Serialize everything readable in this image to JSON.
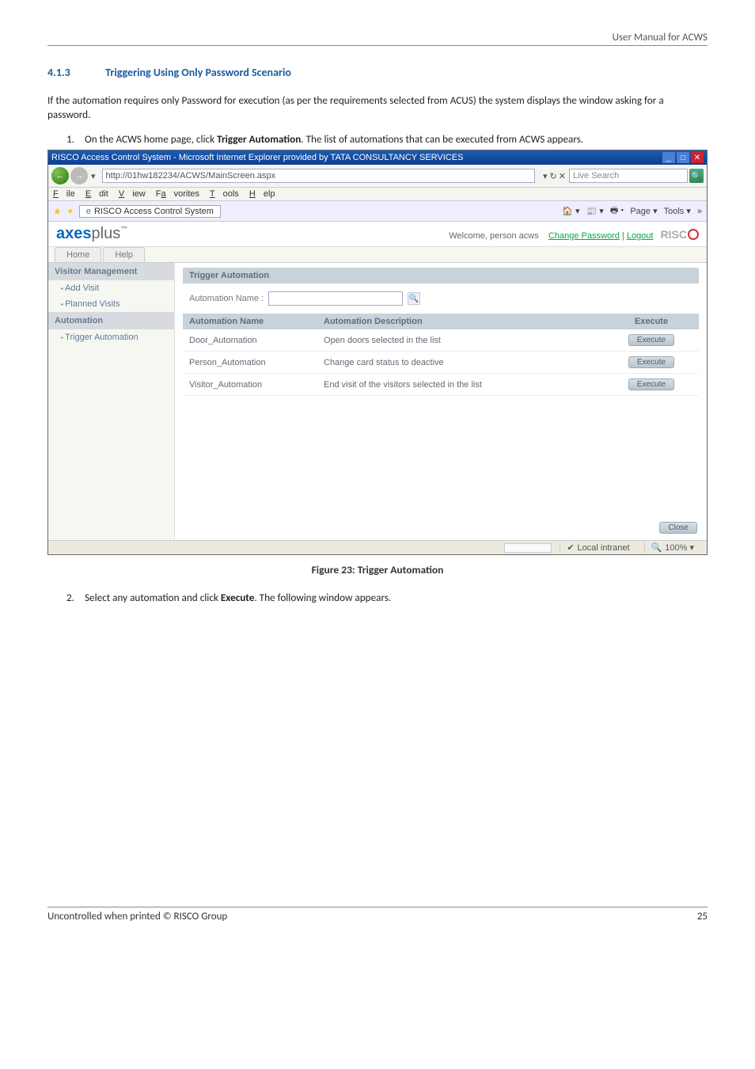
{
  "header": {
    "right": "User Manual for ACWS"
  },
  "section": {
    "number": "4.1.3",
    "title": "Triggering Using Only Password Scenario"
  },
  "body": {
    "para1": "If the automation requires only Password for execution (as per the requirements selected from ACUS) the system displays the window asking for a password.",
    "step1_prefix": "On the ACWS home page, click ",
    "step1_bold": "Trigger Automation",
    "step1_suffix": ". The list of automations that can be executed from ACWS appears.",
    "step2_prefix": "Select any automation and click ",
    "step2_bold": "Execute",
    "step2_suffix": ". The following window appears."
  },
  "figure": {
    "caption": "Figure 23: Trigger Automation"
  },
  "footer": {
    "left": "Uncontrolled when printed © RISCO Group",
    "right": "25"
  },
  "screenshot": {
    "titlebar": {
      "title": "RISCO Access Control System - Microsoft Internet Explorer provided by TATA CONSULTANCY SERVICES",
      "min": "_",
      "max": "□",
      "close": "✕"
    },
    "address": {
      "url": "http://01hw182234/ACWS/MainScreen.aspx",
      "live_search": "Live Search",
      "go": "→",
      "refresh_dd": "✕"
    },
    "menu": {
      "file": "File",
      "edit": "Edit",
      "view": "View",
      "favorites": "Favorites",
      "tools": "Tools",
      "help": "Help"
    },
    "tab": {
      "active": "RISCO Access Control System"
    },
    "ie_tools": {
      "page": "Page ▾",
      "tools": "Tools ▾"
    },
    "app": {
      "brand_axes": "axes",
      "brand_plus": "plus",
      "brand_tm": "™",
      "welcome": "Welcome, person acws",
      "change_pw": "Change Password",
      "sep": " | ",
      "logout": "Logout",
      "risco": "RISC"
    },
    "apptabs": {
      "home": "Home",
      "help": "Help"
    },
    "sidebar": {
      "group1": "Visitor Management",
      "i1": "Add Visit",
      "i2": "Planned Visits",
      "group2": "Automation",
      "i3": "Trigger Automation"
    },
    "panel": {
      "title": "Trigger Automation",
      "filter_label": "Automation Name :",
      "filter_value": "",
      "search_icon": "🔍",
      "col_name": "Automation Name",
      "col_desc": "Automation Description",
      "col_exec": "Execute",
      "rows": [
        {
          "name": "Door_Automation",
          "desc": "Open doors selected in the list",
          "exec": "Execute"
        },
        {
          "name": "Person_Automation",
          "desc": "Change card status to deactive",
          "exec": "Execute"
        },
        {
          "name": "Visitor_Automation",
          "desc": "End visit of the visitors selected in the list",
          "exec": "Execute"
        }
      ],
      "close": "Close"
    },
    "status": {
      "intranet": "Local intranet",
      "zoom": "100%  ▾"
    }
  }
}
